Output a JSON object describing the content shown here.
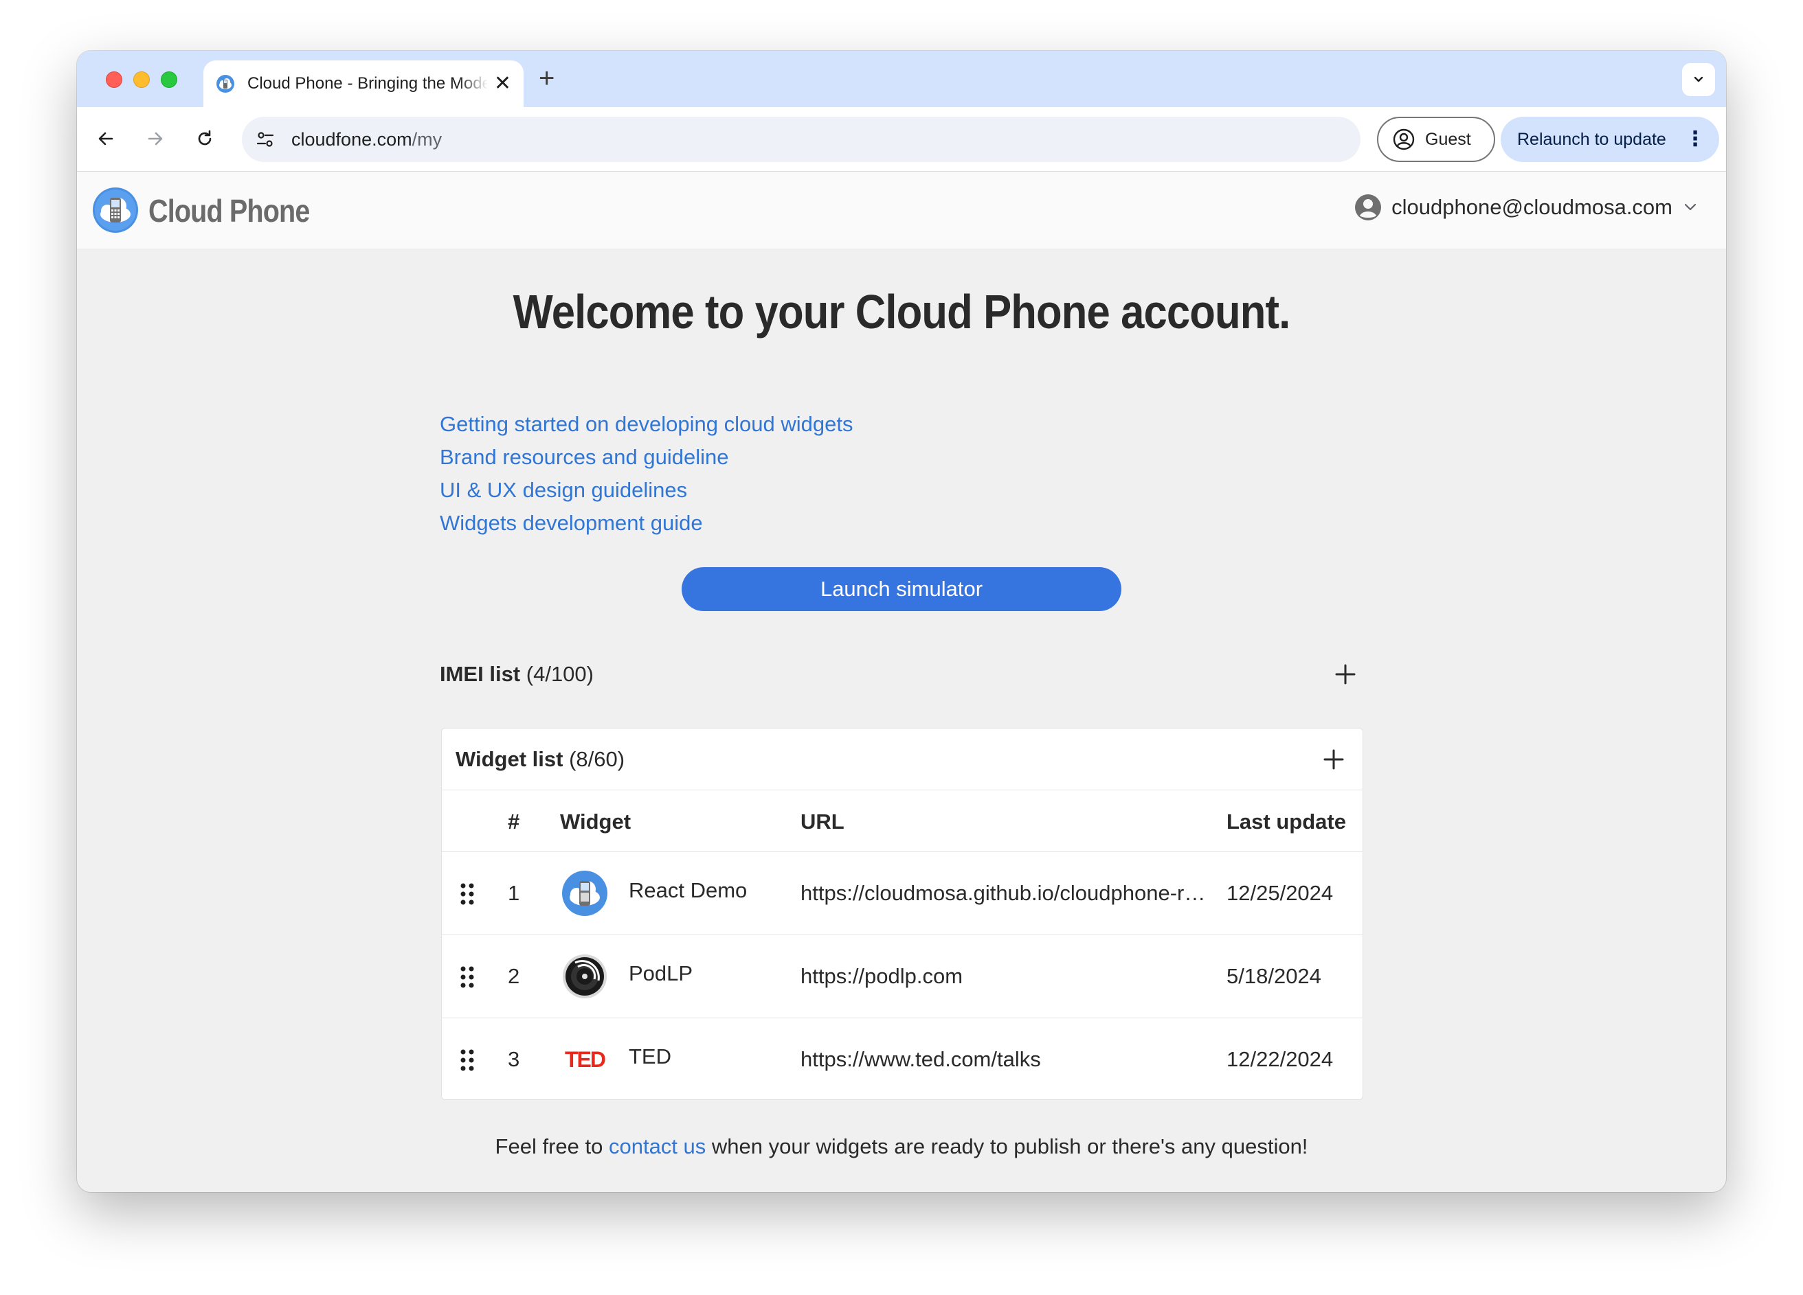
{
  "browser": {
    "tab_title": "Cloud Phone - Bringing the Modern Web to Feature Phones",
    "new_tab_symbol": "+",
    "close_symbol": "✕",
    "url_host": "cloudfone.com",
    "url_path": "/my",
    "guest_label": "Guest",
    "relaunch_label": "Relaunch to update",
    "menu_symbol": "⋮"
  },
  "site": {
    "logo_text": "Cloud Phone",
    "account_email": "cloudphone@cloudmosa.com"
  },
  "main": {
    "headline": "Welcome to your Cloud Phone account.",
    "links": [
      "Getting started on developing cloud widgets",
      "Brand resources and guideline",
      "UI & UX design guidelines",
      "Widgets development guide"
    ],
    "launch_label": "Launch simulator",
    "imei": {
      "title": "IMEI list",
      "count": "(4/100)"
    }
  },
  "widgets": {
    "title": "Widget list",
    "count": "(8/60)",
    "columns": {
      "num": "#",
      "widget": "Widget",
      "url": "URL",
      "updated": "Last update"
    },
    "rows": [
      {
        "num": "1",
        "name": "React Demo",
        "url": "https://cloudmosa.github.io/cloudphone-react-demo",
        "date": "12/25/2024",
        "icon": "cloud-phone-logo-icon"
      },
      {
        "num": "2",
        "name": "PodLP",
        "url": "https://podlp.com",
        "date": "5/18/2024",
        "icon": "podlp-logo-icon"
      },
      {
        "num": "3",
        "name": "TED",
        "url": "https://www.ted.com/talks",
        "date": "12/22/2024",
        "icon": "ted-logo-icon",
        "icon_text": "TED"
      }
    ]
  },
  "footer": {
    "before": "Feel free to ",
    "link": "contact us",
    "after": " when your widgets are ready to publish or there's any question!"
  },
  "colors": {
    "accent": "#3674e0",
    "link": "#3176d4",
    "tabstrip": "#d3e3fd",
    "ted_red": "#e62b1e"
  }
}
